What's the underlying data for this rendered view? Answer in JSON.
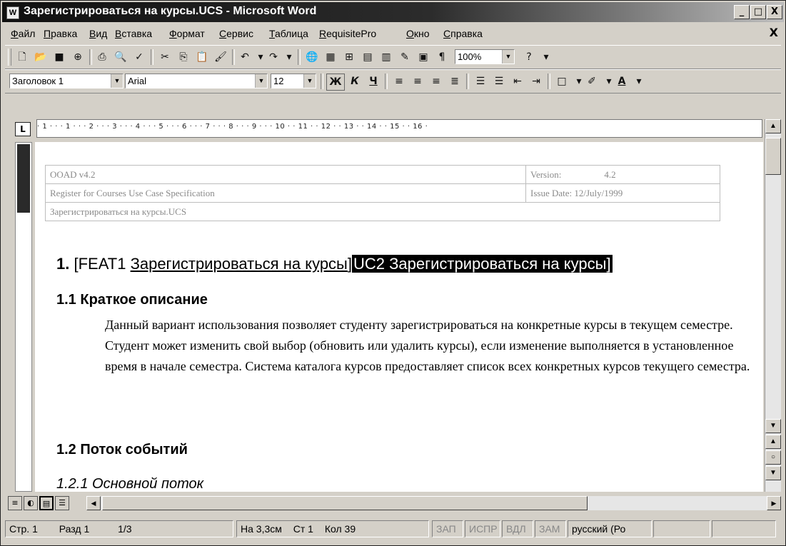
{
  "window": {
    "title": "Зарегистрироваться на курсы.UCS - Microsoft Word",
    "app_icon": "word-icon",
    "controls": [
      "_",
      "□",
      "X"
    ]
  },
  "menu": {
    "items": [
      "Файл",
      "Правка",
      "Вид",
      "Вставка",
      "Формат",
      "Сервис",
      "Таблица",
      "RequisitePro",
      "Окно",
      "Справка"
    ],
    "close_glyph": "X"
  },
  "standard_toolbar": {
    "zoom": "100%"
  },
  "format_toolbar": {
    "style": "Заголовок 1",
    "font": "Arial",
    "size": "12",
    "bold": "Ж",
    "italic": "К",
    "underline": "Ч"
  },
  "ruler": {
    "tab_selector": "L",
    "marks": "· 1 · · · 1 · · · 2 · · · 3 · · · 4 · · · 5 · · · 6 · · · 7 · · · 8 · · · 9 · · · 10 · · 11 · · 12 · · 13 · · 14 · · 15 · · 16 ·"
  },
  "document": {
    "header": {
      "row1_left": "OOAD v4.2",
      "row1_right_label": "Version:",
      "row1_right_value": "4.2",
      "row2_left": "Register for Courses Use Case Specification",
      "row2_right_label": "Issue Date:",
      "row2_right_value": "12/July/1999",
      "row3_left": "Зарегистрироваться на курсы.UCS"
    },
    "heading1": {
      "number": "1.",
      "open_bracket": "[",
      "feat_tag": "FEAT1",
      "feat_text": "Зарегистрироваться на курсы",
      "close_bracket": "]",
      "uc_text": "UC2 Зарегистрироваться на курсы",
      "end_bracket": "]"
    },
    "heading2_desc": "1.1  Краткое описание",
    "paragraph": "Данный вариант использования позволяет студенту зарегистрироваться на конкретные курсы в текущем семестре. Студент может изменить свой выбор (обновить или удалить курсы), если изменение выполняется в установленное время в начале семестра. Система каталога курсов предоставляет список всех конкретных курсов текущего семестра.",
    "heading2_flow": "1.2  Поток событий",
    "heading3_main": "1.2.1  Основной поток"
  },
  "status_bar": {
    "page": "Стр. 1",
    "section": "Разд 1",
    "pages": "1/3",
    "at": "На 3,3см",
    "line": "Ст 1",
    "col": "Кол 39",
    "rec": "ЗАП",
    "trk": "ИСПР",
    "ext": "ВДЛ",
    "ovr": "ЗАМ",
    "language": "русский (Ро"
  }
}
